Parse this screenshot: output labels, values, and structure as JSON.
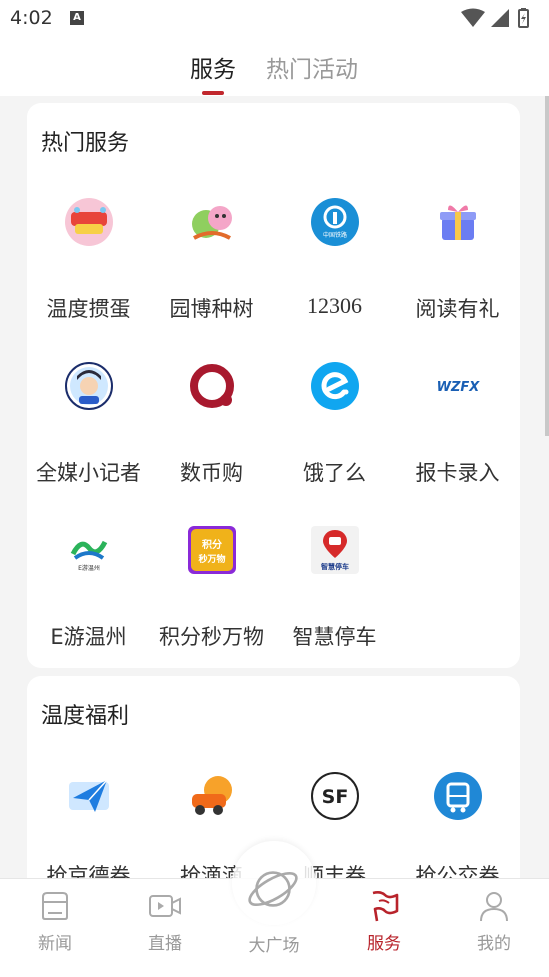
{
  "status_bar": {
    "time": "4:02",
    "a_badge": "A"
  },
  "tabs": [
    {
      "label": "服务",
      "active": true
    },
    {
      "label": "热门活动",
      "active": false
    }
  ],
  "hot_services": {
    "title": "热门服务",
    "items": [
      {
        "label": "温度掼蛋",
        "icon": "guandan-game-icon"
      },
      {
        "label": "园博种树",
        "icon": "tree-planting-icon"
      },
      {
        "label": "12306",
        "icon": "china-railway-icon",
        "icon_text": "中国铁路"
      },
      {
        "label": "阅读有礼",
        "icon": "gift-box-icon"
      },
      {
        "label": "全媒小记者",
        "icon": "kid-reporter-icon"
      },
      {
        "label": "数币购",
        "icon": "digital-currency-icon"
      },
      {
        "label": "饿了么",
        "icon": "eleme-icon"
      },
      {
        "label": "报卡录入",
        "icon": "wzfx-icon",
        "icon_text": "WZFX"
      },
      {
        "label": "E游温州",
        "icon": "e-tour-wenzhou-icon",
        "icon_text": "E游温州"
      },
      {
        "label": "积分秒万物",
        "icon": "points-icon",
        "icon_text": "积分秒万物"
      },
      {
        "label": "智慧停车",
        "icon": "smart-parking-icon",
        "icon_text": "智慧停车"
      }
    ]
  },
  "welfare": {
    "title": "温度福利",
    "items": [
      {
        "label": "抢京德券",
        "icon": "paper-plane-icon"
      },
      {
        "label": "抢滴滴",
        "icon": "didi-car-icon"
      },
      {
        "label": "顺丰券",
        "icon": "sf-express-icon",
        "icon_text": "SF"
      },
      {
        "label": "抢公交券",
        "icon": "bus-icon"
      }
    ]
  },
  "bottom_nav": [
    {
      "label": "新闻",
      "icon": "news-icon",
      "active": false
    },
    {
      "label": "直播",
      "icon": "live-video-icon",
      "active": false
    },
    {
      "label": "大广场",
      "icon": "planet-icon",
      "active": false
    },
    {
      "label": "服务",
      "icon": "service-flag-icon",
      "active": true
    },
    {
      "label": "我的",
      "icon": "profile-icon",
      "active": false
    }
  ],
  "colors": {
    "accent": "#c1272d",
    "nav_active": "#b8232b",
    "nav_inactive": "#999999"
  }
}
